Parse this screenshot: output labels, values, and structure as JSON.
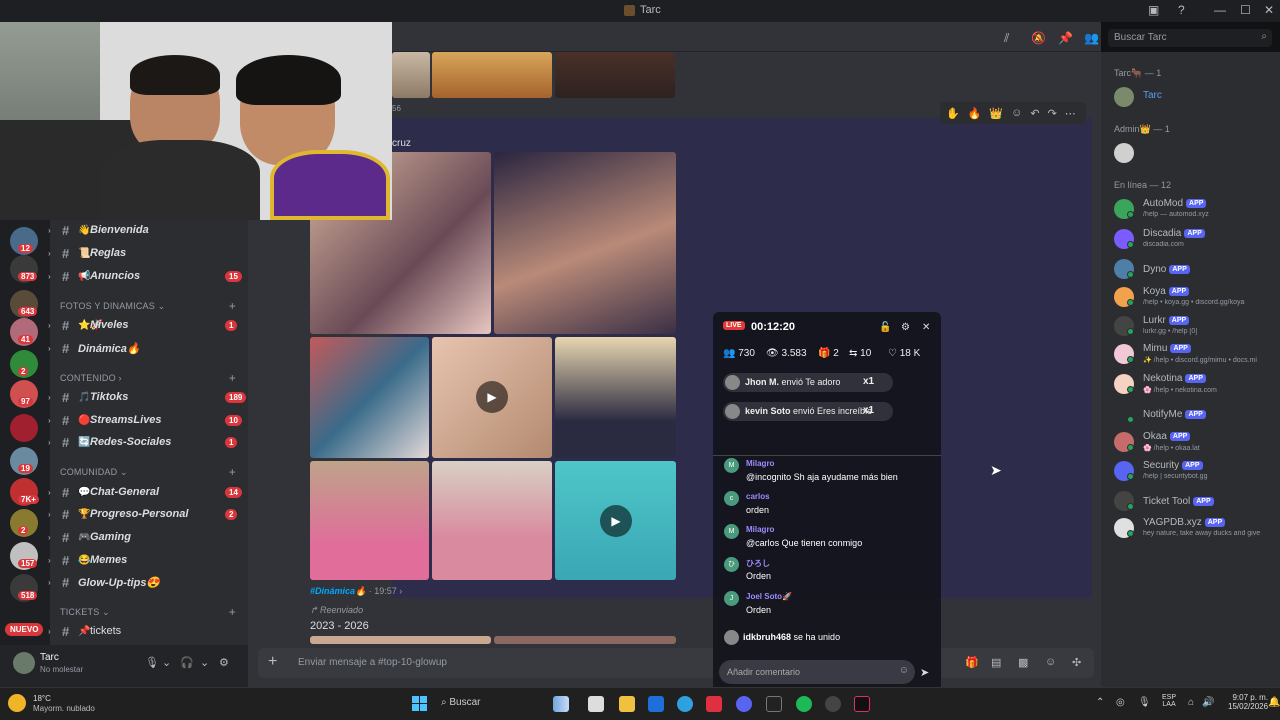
{
  "window": {
    "title": "Tarc",
    "min": "—",
    "max": "☐",
    "close": "✕",
    "help": "?",
    "inbox": "▣"
  },
  "colors": {
    "accent": "#5865f2",
    "badge": "#da373c",
    "online": "#23a55a",
    "live": "#e53935",
    "link": "#00a8fc"
  },
  "servers": [
    {
      "badge": "12"
    },
    {
      "badge": "873"
    },
    {
      "badge": "643"
    },
    {
      "badge": "41"
    },
    {
      "badge": "2"
    },
    {
      "badge": "97"
    },
    {
      "badge": ""
    },
    {
      "badge": "19"
    },
    {
      "badge": "7K+"
    },
    {
      "badge": "2"
    },
    {
      "badge": "157"
    },
    {
      "badge": "518"
    }
  ],
  "nuevo": "NUEVO",
  "channels": {
    "items": [
      {
        "emoji": "👋",
        "name": "Bienvenida",
        "badge": ""
      },
      {
        "emoji": "📜",
        "name": "Reglas",
        "badge": ""
      },
      {
        "emoji": "📢",
        "name": "Anuncios",
        "badge": "15"
      }
    ],
    "cat_fotos": "FOTOS Y DINAMICAS ⌄",
    "fotos": [
      {
        "emoji": "⭐🚀",
        "name": "Niveles",
        "badge": "1"
      },
      {
        "emoji": "",
        "name": "Dinámica🔥",
        "badge": ""
      }
    ],
    "cat_contenido": "CONTENIDO ›",
    "contenido": [
      {
        "emoji": "🎵",
        "name": "Tiktoks",
        "badge": "189"
      },
      {
        "emoji": "🔴",
        "name": "StreamsLives",
        "badge": "10"
      },
      {
        "emoji": "🔄",
        "name": "Redes-Sociales",
        "badge": "1"
      }
    ],
    "cat_comunidad": "COMUNIDAD ⌄",
    "comunidad": [
      {
        "emoji": "💬",
        "name": "Chat-General",
        "badge": "14"
      },
      {
        "emoji": "🏆",
        "name": "Progreso-Personal",
        "badge": "2"
      },
      {
        "emoji": "🎮",
        "name": "Gaming",
        "badge": ""
      },
      {
        "emoji": "😂",
        "name": "Memes",
        "badge": ""
      },
      {
        "emoji": "",
        "name": "Glow-Up-tips😍",
        "badge": ""
      }
    ],
    "cat_tickets": "TICKETS ⌄",
    "tickets": [
      {
        "emoji": "📌",
        "name": "tickets",
        "badge": ""
      }
    ]
  },
  "user": {
    "name": "Tarc",
    "status": "No molestar"
  },
  "header": {
    "search_placeholder": "Buscar Tarc"
  },
  "chat": {
    "partial_number": "56",
    "author_fragment": "cruz",
    "footer_channel": "#Dinámica🔥",
    "footer_time": "· 19:57 ›",
    "forwarded": "↱ Reenviado",
    "date_text": "2023 - 2026",
    "composer_placeholder": "Enviar mensaje a #top-10-glowup"
  },
  "members": {
    "owner_header": "Tarc🐂 — 1",
    "owner_name": "Tarc",
    "admin_header": "Admin👑 — 1",
    "online_header": "En línea — 12",
    "app_tag": "APP",
    "bots": [
      {
        "name": "AutoMod",
        "status": "/help — automod.xyz",
        "color": "#3ba55c"
      },
      {
        "name": "Discadia",
        "status": "discadia.com",
        "color": "#7b5cff"
      },
      {
        "name": "Dyno",
        "status": "",
        "color": "#4e7fa8"
      },
      {
        "name": "Koya",
        "status": "/help • koya.gg • discord.gg/koya",
        "color": "#f2a24a"
      },
      {
        "name": "Lurkr",
        "status": "lurkr.gg • /help [0]",
        "color": "#444"
      },
      {
        "name": "Mimu",
        "status": "✨ /help • discord.gg/mimu • docs.mi",
        "color": "#f3c8d6"
      },
      {
        "name": "Nekotina",
        "status": "🌸 /help • nekotina.com",
        "color": "#f5d2c2"
      },
      {
        "name": "NotifyMe",
        "status": "",
        "color": "#2b2d31"
      },
      {
        "name": "Okaa",
        "status": "🌸 /help • okaa.lat",
        "color": "#c56b6b"
      },
      {
        "name": "Security",
        "status": "/help | securitybot.gg",
        "color": "#5865f2"
      },
      {
        "name": "Ticket Tool",
        "status": "",
        "color": "#444"
      },
      {
        "name": "YAGPDB.xyz",
        "status": "hey nature, take away ducks and give",
        "color": "#e0e0e0"
      }
    ]
  },
  "live": {
    "badge": "LIVE",
    "time": "00:12:20",
    "stats": [
      "730",
      "3.583",
      "2",
      "10",
      "18 K"
    ],
    "gifts": [
      {
        "user": "Jhon M.",
        "text": "envió Te adoro",
        "count": "x1"
      },
      {
        "user": "kevin Soto",
        "text": "envió Eres increíble",
        "count": "x1"
      }
    ],
    "comments": [
      {
        "initial": "M",
        "name": "Milagro",
        "text": "@incognito Sh aja ayudame más bien"
      },
      {
        "initial": "c",
        "name": "carlos",
        "text": "orden"
      },
      {
        "initial": "M",
        "name": "Milagro",
        "text": "@carlos Que tienen conmigo"
      },
      {
        "initial": "ひ",
        "name": "ひろし",
        "text": "Orden"
      },
      {
        "initial": "J",
        "name": "Joel Soto🚀",
        "text": "Orden"
      }
    ],
    "joined_user": "idkbruh468",
    "joined_text": "se ha unido",
    "comment_placeholder": "Añadir comentario"
  },
  "taskbar": {
    "temp": "18°C",
    "weather": "Mayorm. nublado",
    "search": "Buscar",
    "lang1": "ESP",
    "lang2": "LAA",
    "time": "9:07 p. m.",
    "date": "15/02/2026"
  }
}
